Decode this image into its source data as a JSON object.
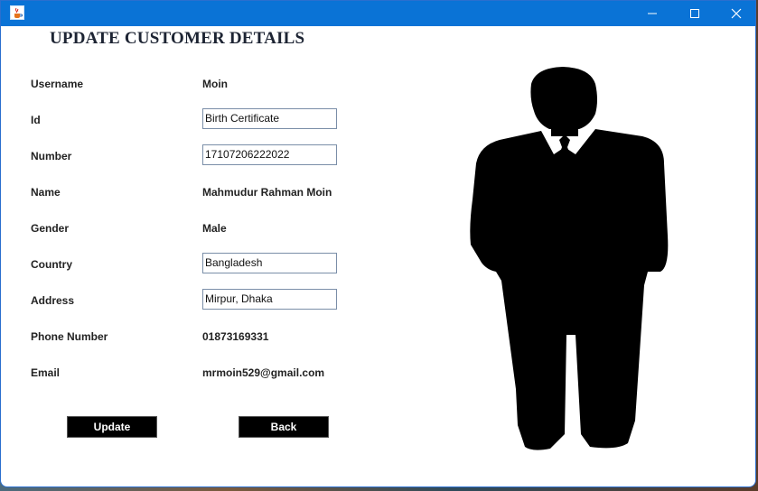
{
  "page": {
    "heading": "UPDATE CUSTOMER DETAILS"
  },
  "fields": {
    "username": {
      "label": "Username",
      "value": "Moin"
    },
    "id": {
      "label": "Id",
      "value": "Birth Certificate"
    },
    "number": {
      "label": "Number",
      "value": "17107206222022"
    },
    "name": {
      "label": "Name",
      "value": "Mahmudur Rahman Moin"
    },
    "gender": {
      "label": "Gender",
      "value": "Male"
    },
    "country": {
      "label": "Country",
      "value": "Bangladesh"
    },
    "address": {
      "label": "Address",
      "value": "Mirpur, Dhaka"
    },
    "phone": {
      "label": "Phone Number",
      "value": "01873169331"
    },
    "email": {
      "label": "Email",
      "value": "mrmoin529@gmail.com"
    }
  },
  "buttons": {
    "update": "Update",
    "back": "Back"
  },
  "icons": {
    "app": "java-coffee-cup-icon",
    "minimize": "minimize-icon",
    "maximize": "maximize-icon",
    "close": "close-icon",
    "figure": "businessman-silhouette"
  },
  "colors": {
    "titlebar": "#0a73d6",
    "button_bg": "#000000",
    "button_text": "#ffffff"
  }
}
